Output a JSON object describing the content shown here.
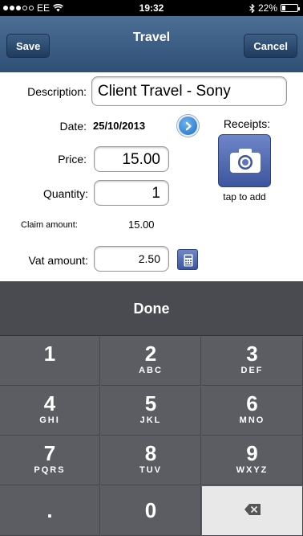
{
  "status_bar": {
    "carrier": "EE",
    "time": "19:32",
    "battery": "22%",
    "battery_level": 0.22
  },
  "nav": {
    "title": "Travel",
    "save_label": "Save",
    "cancel_label": "Cancel"
  },
  "form": {
    "description_label": "Description:",
    "description_value": "Client Travel - Sony",
    "date_label": "Date:",
    "date_value": "25/10/2013",
    "price_label": "Price:",
    "price_value": "15.00",
    "quantity_label": "Quantity:",
    "quantity_value": "1",
    "claim_label": "Claim amount:",
    "claim_value": "15.00",
    "vat_label": "Vat amount:",
    "vat_value": "2.50",
    "receipts_label": "Receipts:",
    "tap_to_add_label": "tap to add"
  },
  "keyboard": {
    "done_label": "Done",
    "keys": [
      {
        "num": "1",
        "letters": ""
      },
      {
        "num": "2",
        "letters": "ABC"
      },
      {
        "num": "3",
        "letters": "DEF"
      },
      {
        "num": "4",
        "letters": "GHI"
      },
      {
        "num": "5",
        "letters": "JKL"
      },
      {
        "num": "6",
        "letters": "MNO"
      },
      {
        "num": "7",
        "letters": "PQRS"
      },
      {
        "num": "8",
        "letters": "TUV"
      },
      {
        "num": "9",
        "letters": "WXYZ"
      },
      {
        "num": ".",
        "letters": ""
      },
      {
        "num": "0",
        "letters": ""
      }
    ]
  },
  "icons": {
    "wifi": "wifi-icon",
    "bluetooth": "bluetooth-icon",
    "date_picker": "chevron-right-icon",
    "camera": "camera-icon",
    "calculator": "calculator-icon",
    "delete": "backspace-icon"
  }
}
